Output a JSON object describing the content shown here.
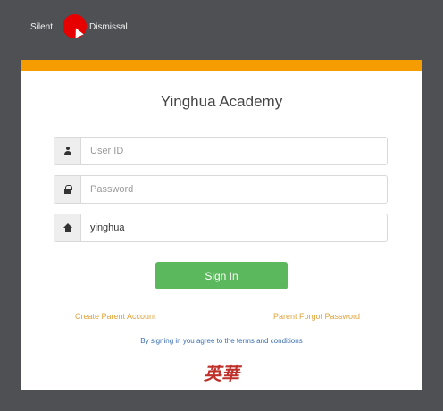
{
  "topbar": {
    "silent_label": "Silent",
    "dismiss_label": "Dismissal"
  },
  "login": {
    "title": "Yinghua Academy",
    "userid": {
      "placeholder": "User ID",
      "value": ""
    },
    "password": {
      "placeholder": "Password",
      "value": ""
    },
    "school": {
      "placeholder": "",
      "value": "yinghua"
    },
    "signin_label": "Sign In",
    "create_parent_label": "Create Parent Account",
    "forgot_password_label": "Parent Forgot Password",
    "terms_label": "By signing in you agree to the terms and conditions",
    "logo_text": "英華"
  },
  "colors": {
    "accent": "#f59c00",
    "signin": "#5cb85c",
    "links": "#e0a33a",
    "terms": "#3a6fb0",
    "logo": "#c0302b",
    "record": "#e60000"
  }
}
